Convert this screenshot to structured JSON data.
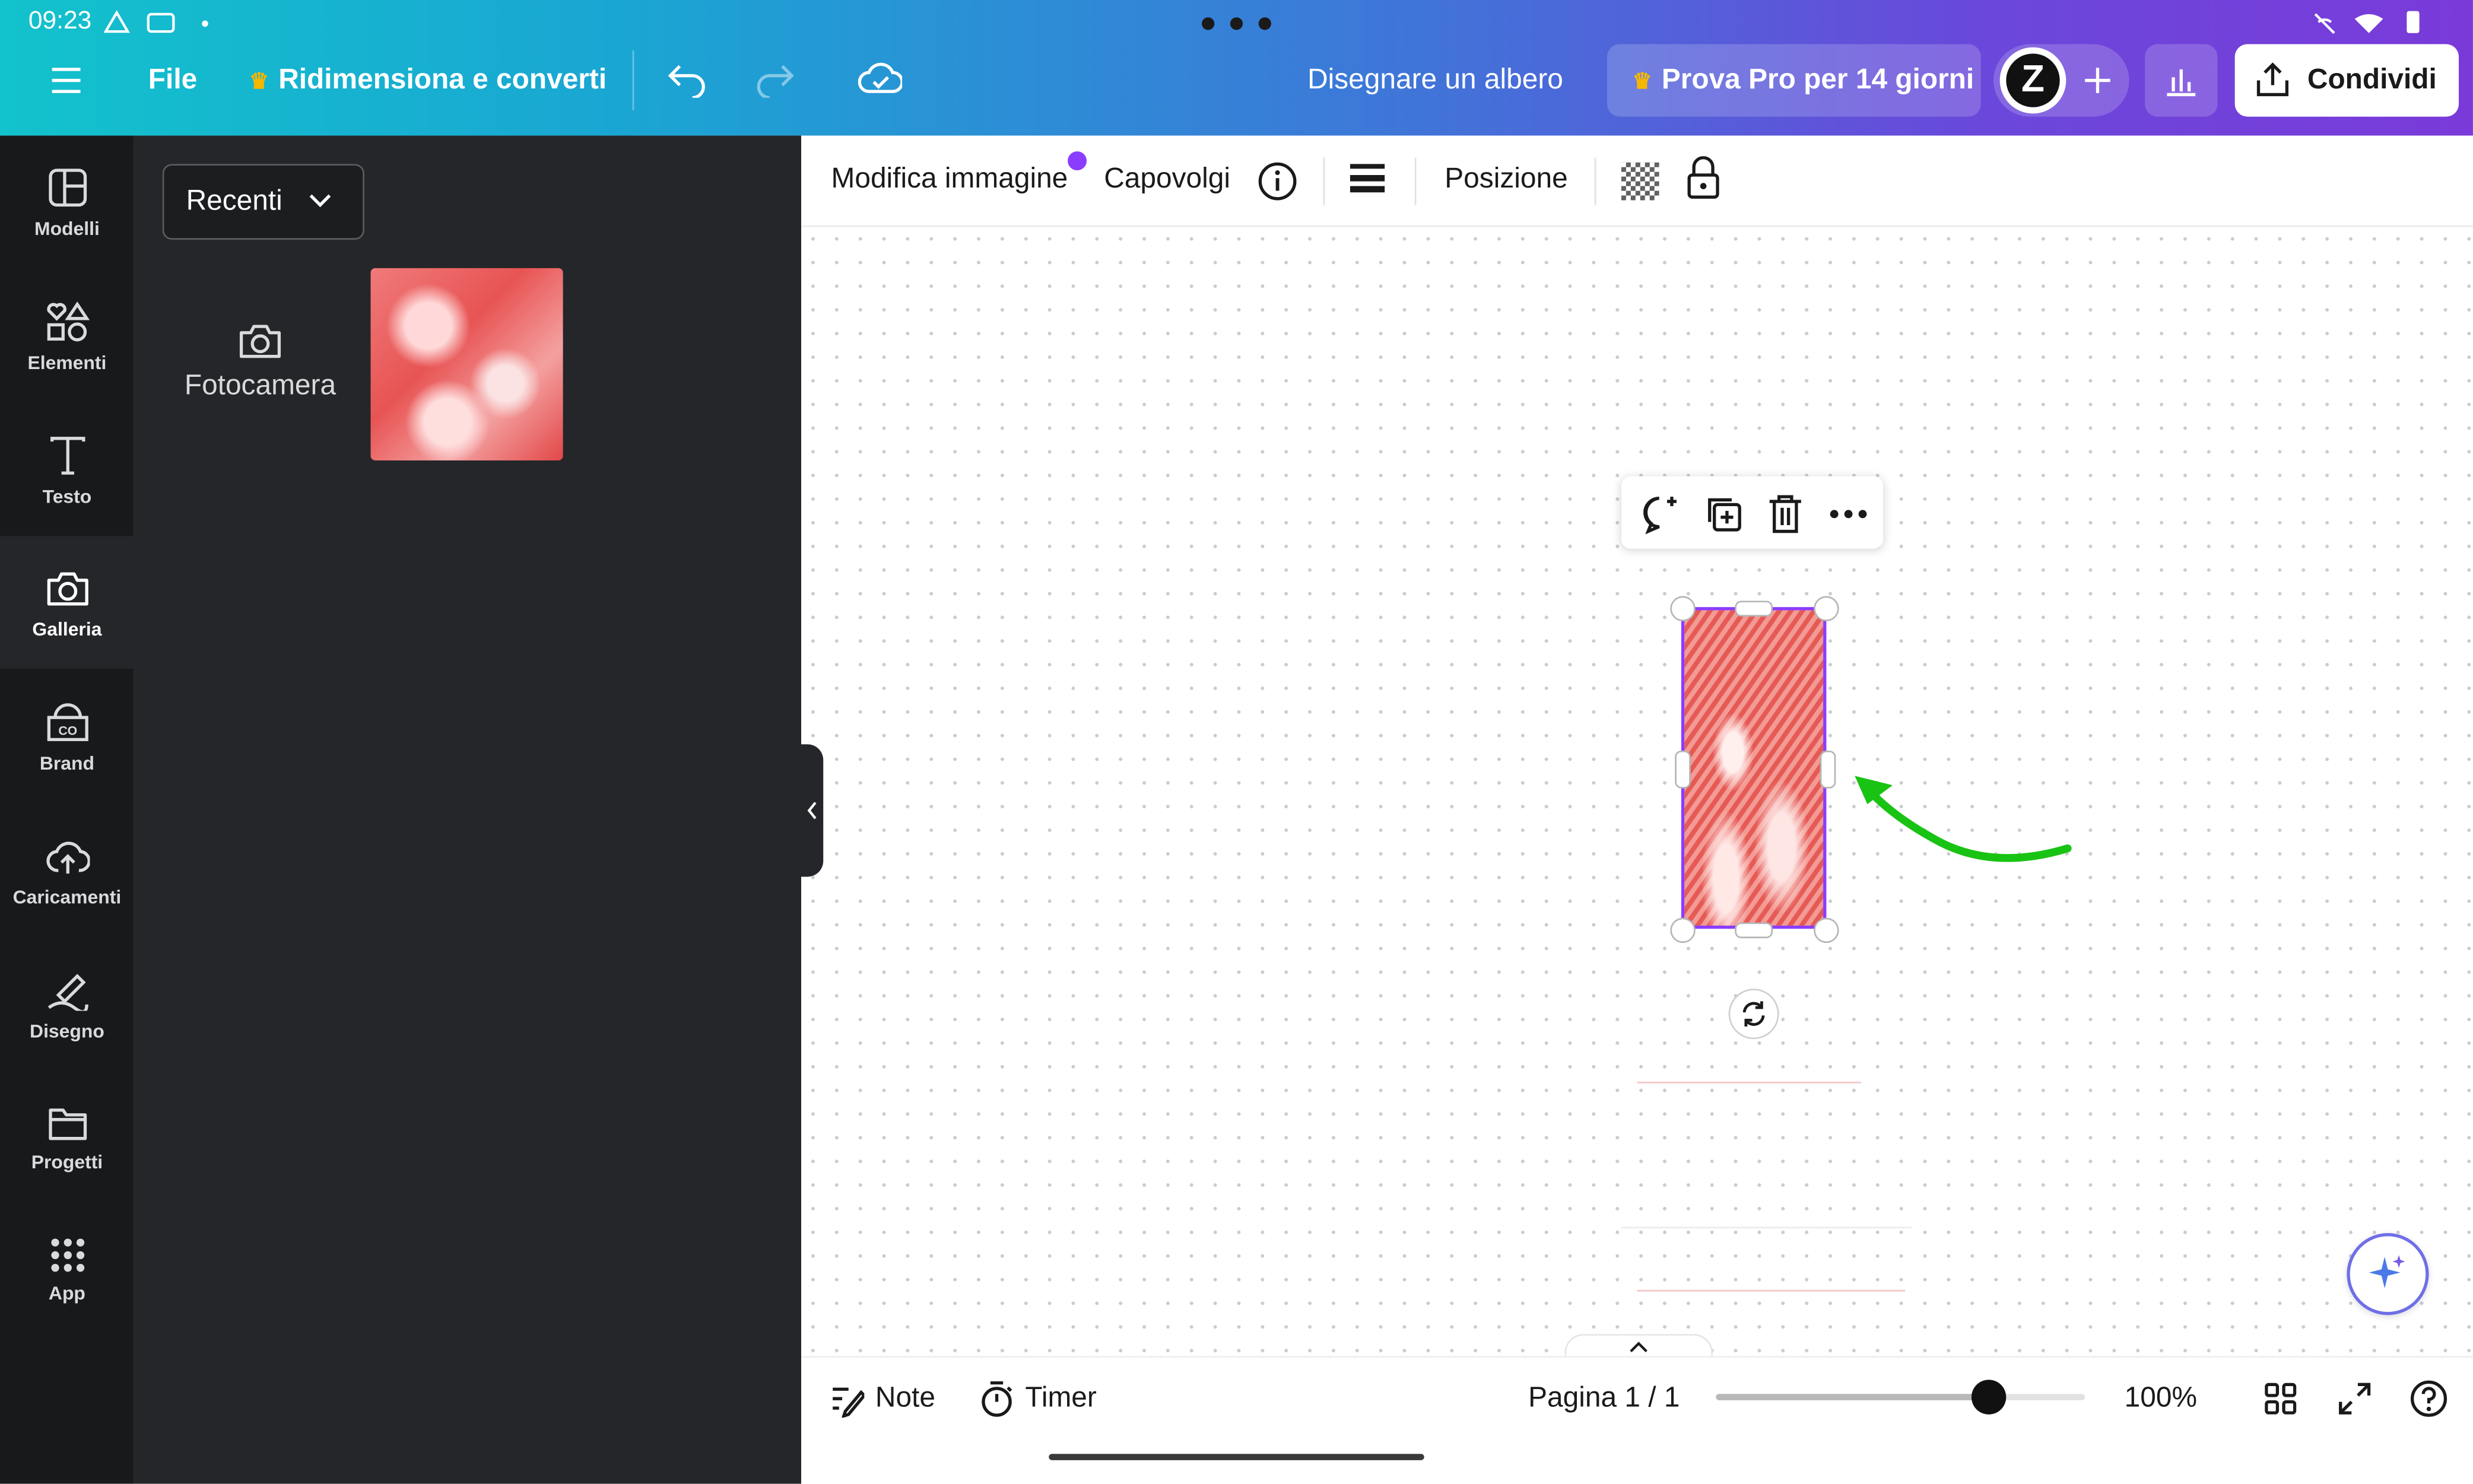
{
  "status": {
    "time": "09:23"
  },
  "topbar": {
    "file_label": "File",
    "resize_label": "Ridimensiona e converti",
    "doc_title": "Disegnare un albero",
    "pro_label": "Prova Pro per 14 giorni",
    "share_label": "Condividi",
    "avatar_letter": "Z"
  },
  "sidebar": {
    "items": [
      {
        "label": "Modelli",
        "icon": "layout-icon"
      },
      {
        "label": "Elementi",
        "icon": "shapes-icon"
      },
      {
        "label": "Testo",
        "icon": "text-icon"
      },
      {
        "label": "Galleria",
        "icon": "camera-icon"
      },
      {
        "label": "Brand",
        "icon": "brand-icon"
      },
      {
        "label": "Caricamenti",
        "icon": "cloud-upload-icon"
      },
      {
        "label": "Disegno",
        "icon": "draw-icon"
      },
      {
        "label": "Progetti",
        "icon": "folder-icon"
      },
      {
        "label": "App",
        "icon": "apps-grid-icon"
      }
    ]
  },
  "panel": {
    "dropdown_label": "Recenti",
    "camera_label": "Fotocamera"
  },
  "context_toolbar": {
    "edit_image": "Modifica immagine",
    "flip": "Capovolgi",
    "position": "Posizione"
  },
  "bottombar": {
    "notes": "Note",
    "timer": "Timer",
    "page": "Pagina 1 / 1",
    "zoom": "100%",
    "zoom_fraction": 0.74
  },
  "colors": {
    "selection": "#8b3dff",
    "arrow": "#19c313",
    "accent_dot": "#8b3dff",
    "image_red": "#e85a5a"
  }
}
